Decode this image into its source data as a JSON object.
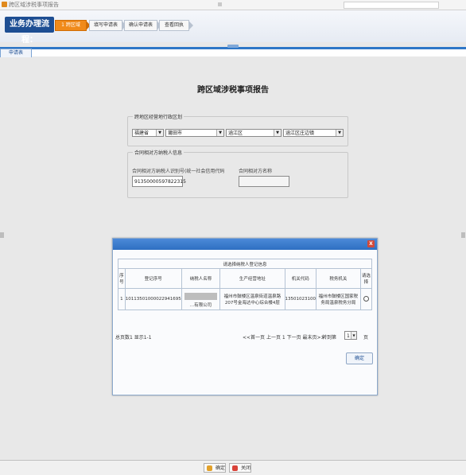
{
  "window": {
    "title": "跨区域涉税事项报告"
  },
  "process": {
    "label": "业务办理流程",
    "steps": [
      {
        "label": "1 跨区域"
      },
      {
        "label": "填写申请表"
      },
      {
        "label": "确认申请表"
      },
      {
        "label": "查看回执"
      }
    ]
  },
  "tab": {
    "label": "申请表"
  },
  "report": {
    "title": "跨区域涉税事项报告"
  },
  "region": {
    "legend": "跨地区经营地行政区划",
    "province": "福建省",
    "city": "莆田市",
    "district": "涵江区",
    "street": "涵江区庄边镇"
  },
  "taxpayer": {
    "legend": "合同相对方纳税人信息",
    "id_label": "合同相对方纳税人识别号(统一社会信用代码",
    "id_value": "91350000597822315",
    "name_label": "合同相对方名称",
    "name_value": ""
  },
  "dialog": {
    "caption": "请选择纳税人登记信息",
    "columns": [
      "序号",
      "登记序号",
      "纳税人名称",
      "生产经营地址",
      "机关代码",
      "税务机关",
      "请选择"
    ],
    "rows": [
      {
        "index": "1",
        "reg_no": "10113501000022941695",
        "name": "...有限公司",
        "address": "福州市鼓楼区温泉街道温泉路207号金海达中心综合楼4层",
        "org_code": "13501023100",
        "tax_office": "福州市鼓楼区国家税务局温泉税务分局"
      }
    ],
    "pager": {
      "summary": "总页数1 显示1-1",
      "nav": "<<首一页 上一页 1 下一页 最末页>>",
      "goto_label": "转到第",
      "page": "1",
      "unit": "页"
    },
    "confirm": "确定",
    "close_glyph": "X"
  },
  "footer": {
    "confirm": "确定",
    "close": "关闭"
  }
}
